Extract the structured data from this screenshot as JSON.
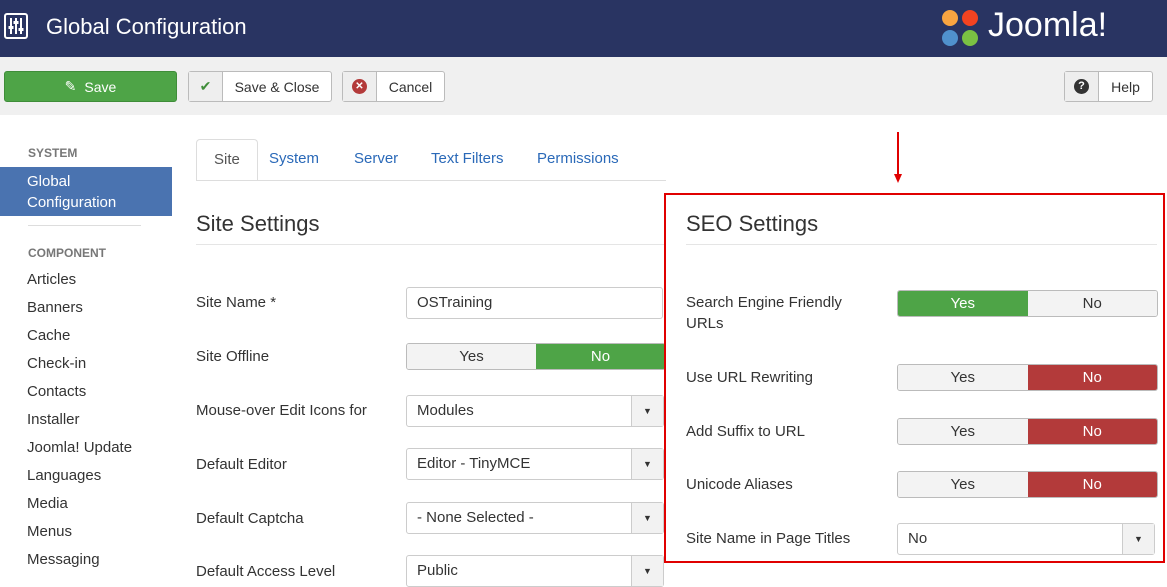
{
  "header": {
    "title": "Global Configuration",
    "logo_text": "Joomla!",
    "icon": "sliders-icon"
  },
  "toolbar": {
    "save": "Save",
    "save_close": "Save & Close",
    "cancel": "Cancel",
    "help": "Help"
  },
  "sidebar": {
    "system_heading": "SYSTEM",
    "active": "Global Configuration",
    "component_heading": "COMPONENT",
    "items": [
      "Articles",
      "Banners",
      "Cache",
      "Check-in",
      "Contacts",
      "Installer",
      "Joomla! Update",
      "Languages",
      "Media",
      "Menus",
      "Messaging"
    ]
  },
  "tabs": [
    "Site",
    "System",
    "Server",
    "Text Filters",
    "Permissions"
  ],
  "site": {
    "heading": "Site Settings",
    "site_name_label": "Site Name *",
    "site_name_value": "OSTraining",
    "offline_label": "Site Offline",
    "offline_yes": "Yes",
    "offline_no": "No",
    "offline_value": "No",
    "mouseover_label": "Mouse-over Edit Icons for",
    "mouseover_value": "Modules",
    "editor_label": "Default Editor",
    "editor_value": "Editor - TinyMCE",
    "captcha_label": "Default Captcha",
    "captcha_value": "- None Selected -",
    "access_label": "Default Access Level",
    "access_value": "Public"
  },
  "seo": {
    "heading": "SEO Settings",
    "highlight_color": "#e00000",
    "rows": [
      {
        "label": "Search Engine Friendly URLs",
        "yes": "Yes",
        "no": "No",
        "value": "Yes"
      },
      {
        "label": "Use URL Rewriting",
        "yes": "Yes",
        "no": "No",
        "value": "No"
      },
      {
        "label": "Add Suffix to URL",
        "yes": "Yes",
        "no": "No",
        "value": "No"
      },
      {
        "label": "Unicode Aliases",
        "yes": "Yes",
        "no": "No",
        "value": "No"
      }
    ],
    "page_titles_label": "Site Name in Page Titles",
    "page_titles_value": "No"
  },
  "colors": {
    "header": "#293462",
    "save": "#4ea447",
    "active_sidebar": "#4a73b0",
    "no_active": "#b33a3a"
  }
}
